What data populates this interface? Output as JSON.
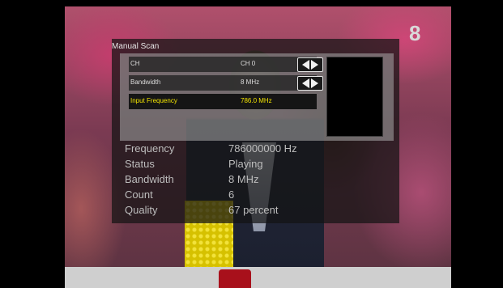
{
  "channel_badge": "8",
  "osd": {
    "title": "Manual Scan",
    "rows": [
      {
        "label": "CH",
        "value": "CH 0"
      },
      {
        "label": "Bandwidth",
        "value": "8 MHz"
      },
      {
        "label": "Input Frequency",
        "value": "786.0 MHz"
      }
    ],
    "info": [
      {
        "key": "Frequency",
        "value": "786000000 Hz"
      },
      {
        "key": "Status",
        "value": "Playing"
      },
      {
        "key": "Bandwidth",
        "value": "8 MHz"
      },
      {
        "key": "Count",
        "value": "6"
      },
      {
        "key": "Quality",
        "value": "67 percent"
      }
    ]
  },
  "colors": {
    "selected_text": "#f3e500",
    "osd_background": "#141414"
  },
  "icons": [
    "left-arrow-icon",
    "right-arrow-icon"
  ]
}
